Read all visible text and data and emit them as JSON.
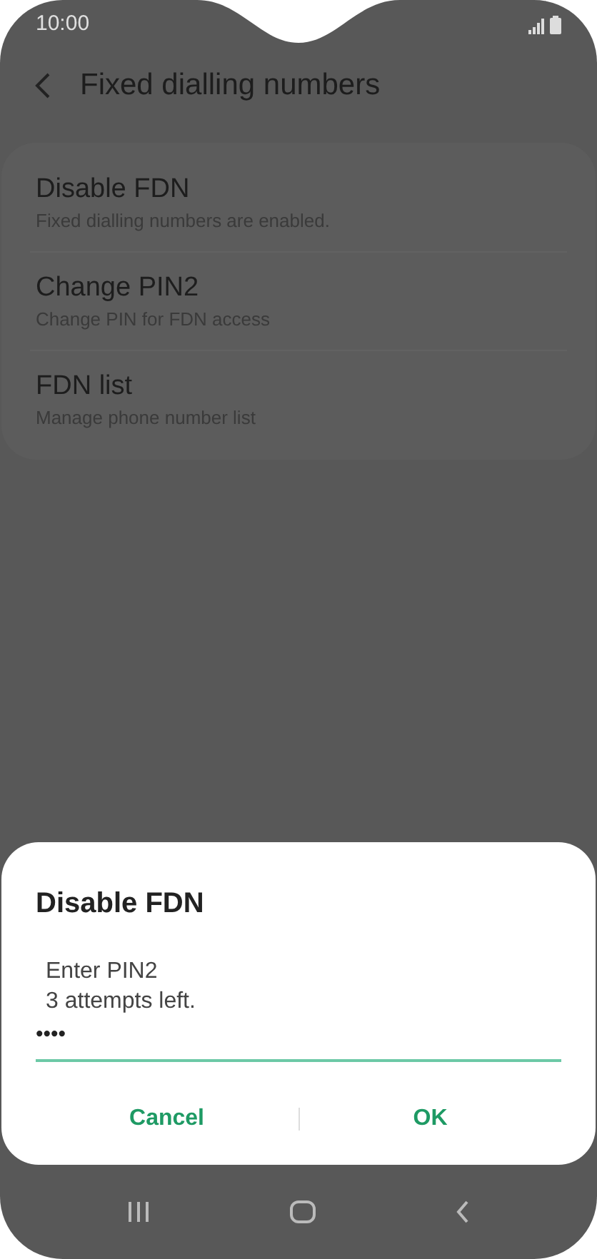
{
  "status_bar": {
    "time": "10:00"
  },
  "header": {
    "title": "Fixed dialling numbers"
  },
  "items": [
    {
      "title": "Disable FDN",
      "subtitle": "Fixed dialling numbers are enabled."
    },
    {
      "title": "Change PIN2",
      "subtitle": "Change PIN for FDN access"
    },
    {
      "title": "FDN list",
      "subtitle": "Manage phone number list"
    }
  ],
  "dialog": {
    "title": "Disable FDN",
    "message_lines": [
      "Enter PIN2",
      "3 attempts left."
    ],
    "pin_value": "••••",
    "buttons": [
      "Cancel",
      "OK"
    ]
  }
}
